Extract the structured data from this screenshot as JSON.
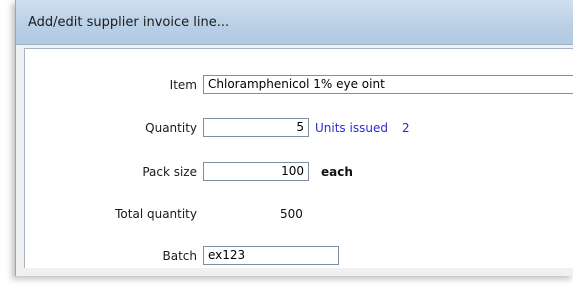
{
  "window": {
    "title": "Add/edit supplier invoice line..."
  },
  "form": {
    "item": {
      "label": "Item",
      "value": "Chloramphenicol 1% eye oint"
    },
    "quantity": {
      "label": "Quantity",
      "value": "5",
      "units_issued_label": "Units issued",
      "units_issued_value": "2"
    },
    "pack_size": {
      "label": "Pack size",
      "value": "100",
      "unit": "each"
    },
    "total_quantity": {
      "label": "Total quantity",
      "value": "500"
    },
    "batch": {
      "label": "Batch",
      "value": "ex123"
    }
  }
}
